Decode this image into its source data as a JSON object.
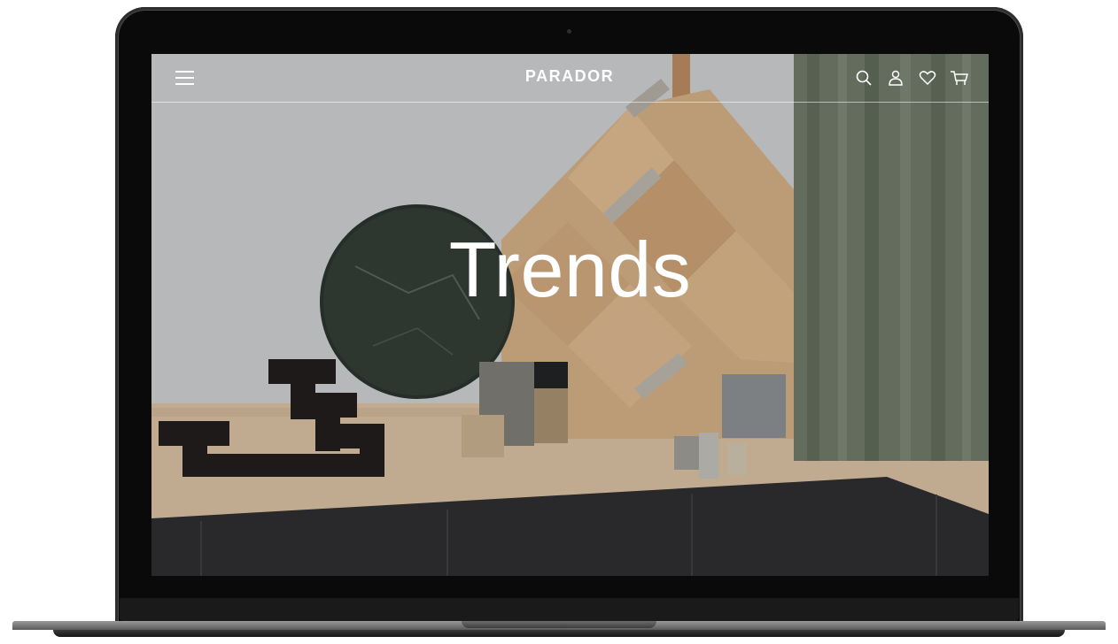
{
  "header": {
    "brand": "PARADOR",
    "icons": [
      "menu-icon",
      "search-icon",
      "user-icon",
      "heart-icon",
      "cart-icon"
    ]
  },
  "hero": {
    "title": "Trends"
  },
  "colors": {
    "nav_text": "#ffffff",
    "bezel": "#0a0a0a",
    "wall": "#c9cbcd",
    "dark_panel": "#2a2a2c"
  }
}
